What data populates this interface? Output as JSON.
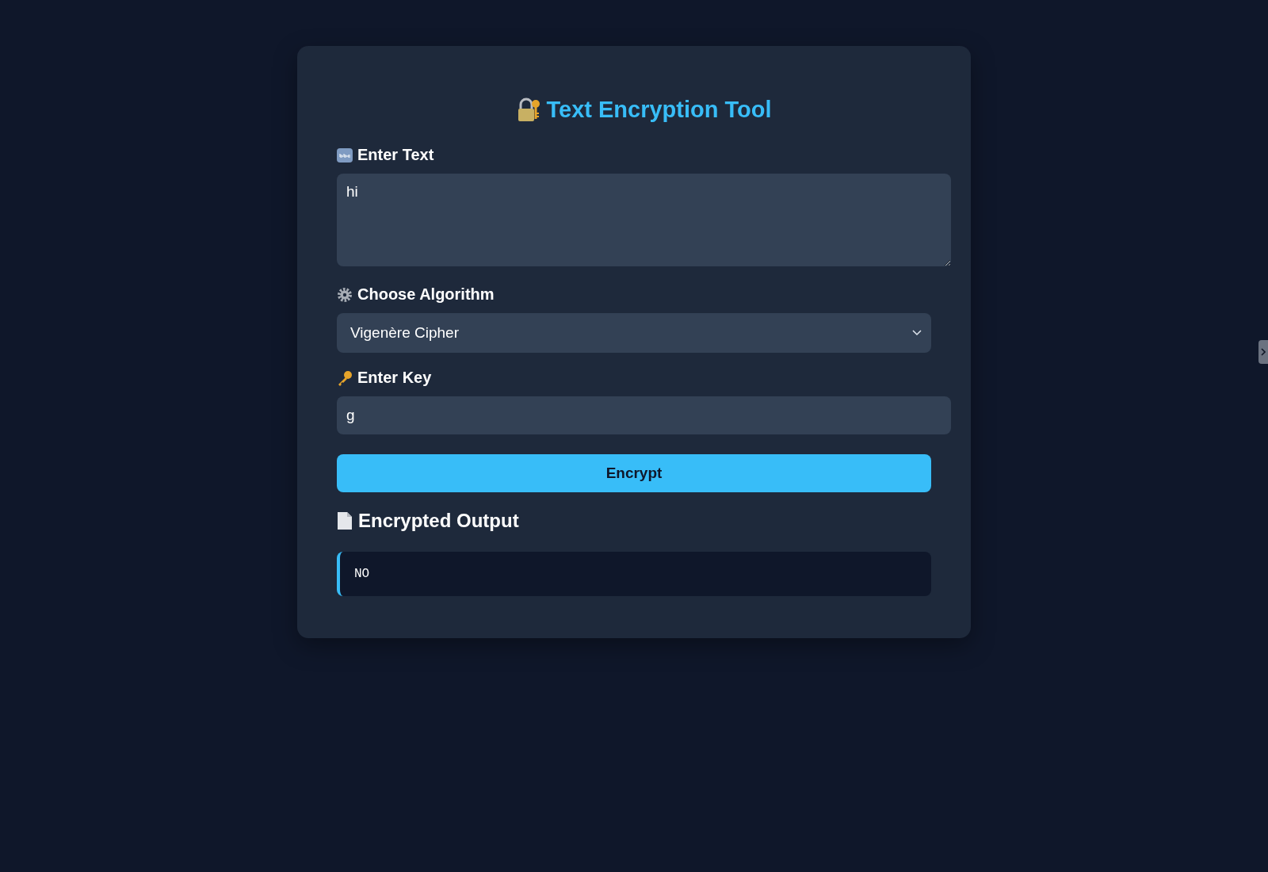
{
  "title": "Text Encryption Tool",
  "text_field": {
    "label": "Enter Text",
    "value": "hi"
  },
  "algorithm_field": {
    "label": "Choose Algorithm",
    "value": "Vigenère Cipher"
  },
  "key_field": {
    "label": "Enter Key",
    "value": "g"
  },
  "encrypt_button": "Encrypt",
  "output": {
    "heading": "Encrypted Output",
    "value": "NO"
  }
}
